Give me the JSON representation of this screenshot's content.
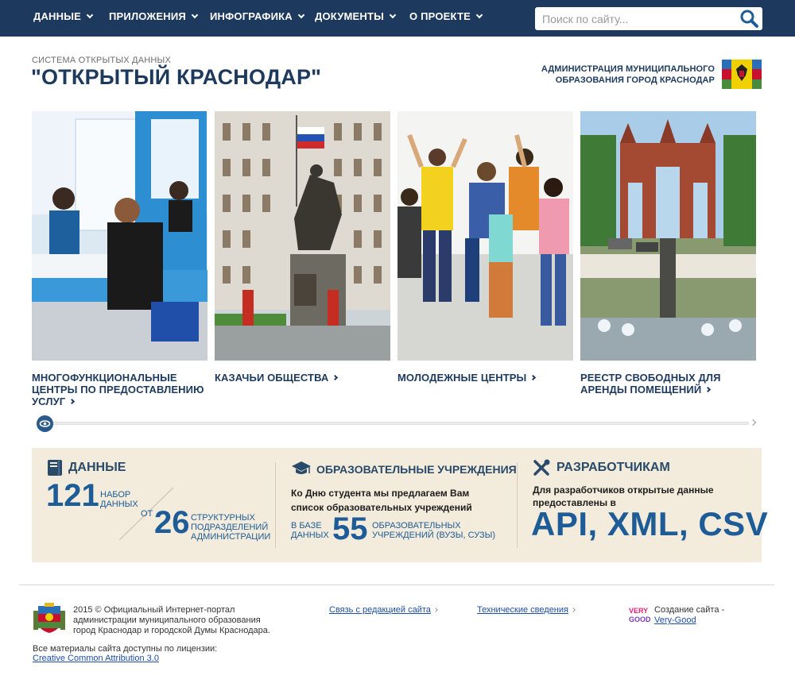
{
  "nav": {
    "items": [
      {
        "label": "ДАННЫЕ"
      },
      {
        "label": "ПРИЛОЖЕНИЯ"
      },
      {
        "label": "ИНФОГРАФИКА"
      },
      {
        "label": "ДОКУМЕНТЫ"
      },
      {
        "label": "О ПРОЕКТЕ"
      }
    ],
    "search_placeholder": "Поиск по сайту..."
  },
  "header": {
    "subtitle": "СИСТЕМА ОТКРЫТЫХ ДАННЫХ",
    "title": "\"ОТКРЫТЫЙ КРАСНОДАР\"",
    "admin_line1": "АДМИНИСТРАЦИЯ МУНИЦИПАЛЬНОГО",
    "admin_line2": "ОБРАЗОВАНИЯ ГОРОД КРАСНОДАР"
  },
  "carousel": {
    "cards": [
      {
        "title": "МНОГОФУНКЦИОНАЛЬНЫЕ ЦЕНТРЫ ПО ПРЕДОСТАВЛЕНИЮ УСЛУГ",
        "image": "office-service-photo"
      },
      {
        "title": "КАЗАЧЬИ ОБЩЕСТВА",
        "image": "cossack-monument-photo"
      },
      {
        "title": "МОЛОДЕЖНЫЕ ЦЕНТРЫ",
        "image": "jumping-youth-photo"
      },
      {
        "title": "РЕЕСТР СВОБОДНЫХ ДЛЯ АРЕНДЫ ПОМЕЩЕНИЙ",
        "image": "triumphal-arch-photo"
      }
    ],
    "scroll_position": 0
  },
  "info": {
    "data": {
      "heading": "ДАННЫЕ",
      "count": "121",
      "count_label_1": "НАБОР",
      "count_label_2": "ДАННЫХ",
      "from": "ОТ",
      "divisions": "26",
      "div_label_1": "СТРУКТУРНЫХ",
      "div_label_2": "ПОДРАЗДЕЛЕНИЙ",
      "div_label_3": "АДМИНИСТРАЦИИ"
    },
    "education": {
      "heading": "ОБРАЗОВАТЕЛЬНЫЕ УЧРЕЖДЕНИЯ",
      "news_1": "Ко Дню студента мы предлагаем Вам",
      "news_2": "список образовательных учреждений",
      "base_1": "В БАЗЕ",
      "base_2": "ДАННЫХ",
      "count": "55",
      "label_1": "ОБРАЗОВАТЕЛЬНЫХ",
      "label_2": "УЧРЕЖДЕНИЙ (ВУЗЫ, СУЗЫ)"
    },
    "dev": {
      "heading": "РАЗРАБОТЧИКАМ",
      "text_1": "Для разработчиков открытые данные",
      "text_2": "предоставлены в",
      "formats": "API, XML, CSV"
    }
  },
  "footer": {
    "copyright_1": "2015 © Официальный Интернет-портал",
    "copyright_2": "администрации муниципального образования",
    "copyright_3": "город Краснодар и городской Думы Краснодара.",
    "license_text": "Все материалы сайта доступны по лицензии:",
    "license_link": "Creative Common Attribution 3.0",
    "contact_link": "Связь с редакцией сайта",
    "tech_link": "Технические сведения",
    "made_by": "Создание сайта -",
    "made_by_link": "Very-Good",
    "logo_text": "VERY GOOD"
  },
  "colors": {
    "nav_bg": "#1d3a5e",
    "accent": "#1d5c96",
    "info_bg": "#f3ebdc"
  }
}
